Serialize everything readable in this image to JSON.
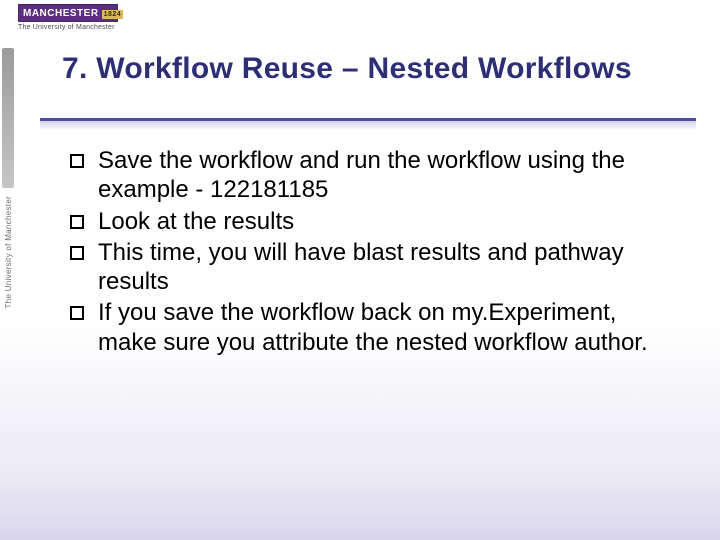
{
  "logo": {
    "name": "MANCHESTER",
    "year": "1824",
    "subtitle": "The University of Manchester"
  },
  "sidebar": {
    "vertical_text": "The University of Manchester"
  },
  "slide": {
    "title": "7. Workflow Reuse – Nested Workflows",
    "bullets": [
      "Save the workflow and run the workflow using the example - 122181185",
      "Look at the results",
      "This time, you will have blast results and pathway results",
      "If you save the workflow back on my.Experiment, make sure you attribute the nested workflow author."
    ]
  }
}
